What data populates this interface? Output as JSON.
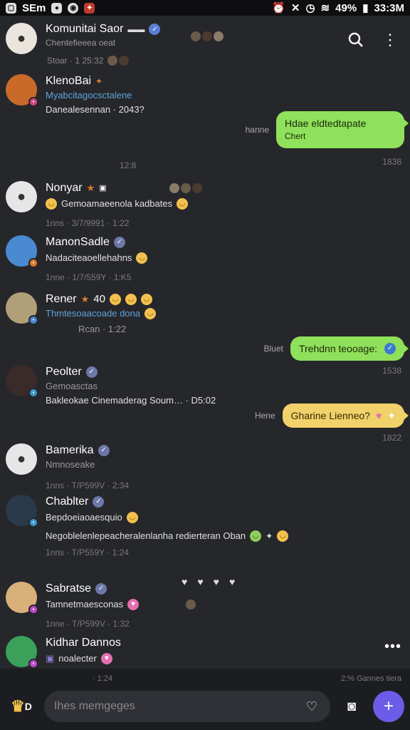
{
  "status_bar": {
    "left_text": "SEm",
    "battery": "49%",
    "time": "33:3M"
  },
  "header": {
    "name": "Komunitai Saor",
    "subtitle": "Chentefieeea oeat",
    "meta": "Stoar · 1 25:32",
    "avatar_color": "#e9e4dc"
  },
  "conversations": [
    {
      "name": "KlenoBai",
      "sub": "Myabcitagocsctalene",
      "body": "Danealesennan · 2043?",
      "time": "",
      "avatar_color": "#c96a2a",
      "badge_color": "#d4477e"
    },
    {
      "name": "Nonyar",
      "sub": "",
      "body": "Gemoamaeenola kadbates",
      "time": "1nns · 3/7/9991 · 1:22",
      "avatar_color": "#e6e6e6"
    },
    {
      "name": "ManonSadle",
      "sub": "",
      "body": "Nadaciteaoellehahns",
      "time": "1nne · 1/7/559Y · 1:K5",
      "avatar_color": "#4a8ad0",
      "badge_color": "#e07a2a"
    },
    {
      "name": "Rener",
      "sub": "",
      "body": "Thmtesoaacoade dona",
      "time": "Rcan · 1:22",
      "avatar_color": "#b0a078",
      "badge_color": "#4a8ad0"
    },
    {
      "name": "Peolter",
      "sub": "Gemoasctas",
      "body": "Bakleokae Cinemaderag Soum… · D5:02",
      "time": "",
      "avatar_color": "#3a2a2a",
      "badge_color": "#3a9ad0"
    },
    {
      "name": "Bamerika",
      "sub": "Nmnoseake",
      "body": "",
      "time": "1nns · T/P599V · 2:34",
      "avatar_color": "#e6e6e6"
    },
    {
      "name": "Chablter",
      "sub": "Bepdoeiaoaesquio",
      "body": "Negoblelenlepeacheralenlanha redierteran Oban",
      "time": "1nns · T/P559Y · 1:24",
      "avatar_color": "#2a3a4a",
      "badge_color": "#3a9ad0"
    },
    {
      "name": "Sabratse",
      "sub": "Tamnetmaesconas",
      "body": "",
      "time": "1nne · T/P599V · 1:32",
      "avatar_color": "#d9b07a",
      "badge_color": "#c24ad0"
    },
    {
      "name": "Kidhar Dannos",
      "sub": "noalecter",
      "body": "",
      "time": "",
      "avatar_color": "#3aa05a",
      "badge_color": "#c24ad0"
    }
  ],
  "bubbles": [
    {
      "label": "hanne",
      "text_line1": "Hdae eldtedtapate",
      "text_line2": "Chert",
      "time": "1838",
      "color": "green"
    },
    {
      "label": "Bluet",
      "text_line1": "Trehdnn teooage:",
      "text_line2": "",
      "time": "1538",
      "color": "green"
    },
    {
      "label": "Hene",
      "text_line1": "Gharine Lienneo?",
      "text_line2": "",
      "time": "1822",
      "color": "yellow"
    }
  ],
  "separator_time": "12:8",
  "bottom": {
    "left_meta": "· 1:24",
    "right_meta": "2:% Gannes tiera",
    "placeholder": "Ihes memgeges"
  }
}
